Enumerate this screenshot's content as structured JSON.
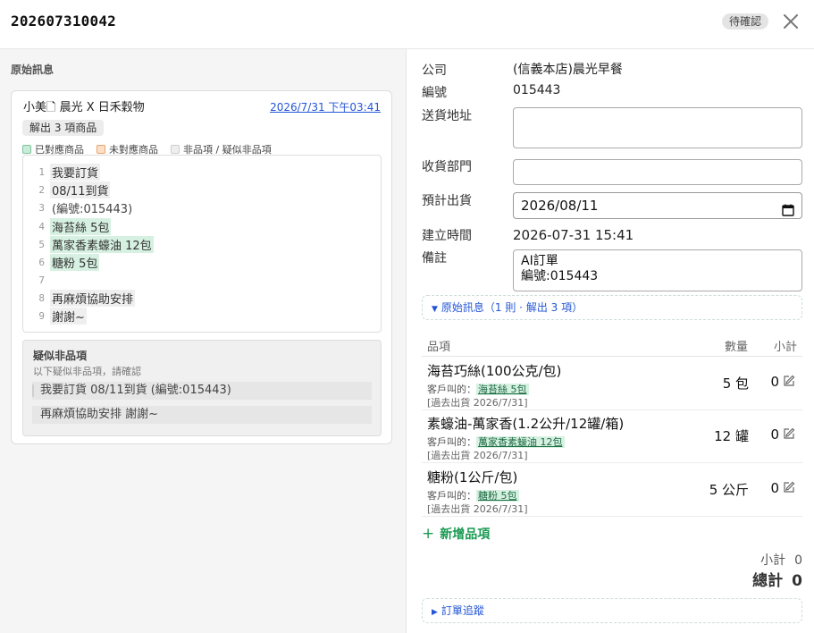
{
  "header": {
    "order_no": "202607310042",
    "status": "待確認"
  },
  "left": {
    "title": "原始訊息",
    "sender": "小美🗋 晨光 X 日禾穀物",
    "time": "2026/7/31 下午03:41",
    "parse_badge": "解出 3 項商品",
    "legend": {
      "matched": "已對應商品",
      "unmatched": "未對應商品",
      "nonitem": "非品項 / 疑似非品項"
    },
    "lines": [
      {
        "n": "1",
        "text": "我要訂貨",
        "kind": "nonitem"
      },
      {
        "n": "2",
        "text": "08/11到貨",
        "kind": "nonitem"
      },
      {
        "n": "3",
        "text": "(編號:015443)",
        "kind": "plain"
      },
      {
        "n": "4",
        "text": "海苔絲 5包",
        "kind": "matched"
      },
      {
        "n": "5",
        "text": "萬家香素蠔油 12包",
        "kind": "matched"
      },
      {
        "n": "6",
        "text": "糖粉 5包",
        "kind": "matched"
      },
      {
        "n": "7",
        "text": "",
        "kind": "plain"
      },
      {
        "n": "8",
        "text": "再麻煩協助安排",
        "kind": "nonitem"
      },
      {
        "n": "9",
        "text": "謝謝~",
        "kind": "nonitem"
      }
    ],
    "suspect": {
      "title": "疑似非品項",
      "subtitle": "以下疑似非品項，請確認",
      "rows": [
        "我要訂貨 08/11到貨 (編號:015443)",
        "再麻煩協助安排 謝謝~"
      ]
    }
  },
  "form": {
    "company_label": "公司",
    "company_value": "(信義本店)晨光早餐",
    "number_label": "編號",
    "number_value": "015443",
    "address_label": "送貨地址",
    "address_value": "",
    "dept_label": "收貨部門",
    "dept_value": "",
    "ship_label": "預計出貨",
    "ship_value": "2026/08/11",
    "created_label": "建立時間",
    "created_value": "2026-07-31 15:41",
    "note_label": "備註",
    "note_line1": "AI訂單",
    "note_line2": "編號:015443"
  },
  "raw_toggle": "原始訊息（1 則 · 解出 3 項）",
  "items": {
    "col_item": "品項",
    "col_qty": "數量",
    "col_sub": "小計",
    "cust_prefix": "客戶叫的：",
    "rows": [
      {
        "name": "海苔巧絲(100公克/包)",
        "cust": "海苔絲 5包",
        "hist": "[過去出貨 2026/7/31]",
        "qty": "5 包",
        "sub": "0"
      },
      {
        "name": "素蠔油-萬家香(1.2公升/12罐/箱)",
        "cust": "萬家香素蠔油 12包",
        "hist": "[過去出貨 2026/7/31]",
        "qty": "12 罐",
        "sub": "0"
      },
      {
        "name": "糖粉(1公斤/包)",
        "cust": "糖粉 5包",
        "hist": "[過去出貨 2026/7/31]",
        "qty": "5 公斤",
        "sub": "0"
      }
    ],
    "add_label": "新增品項"
  },
  "summary": {
    "subtotal_label": "小計",
    "subtotal_value": "0",
    "total_label": "總計",
    "total_value": "0"
  },
  "tracking_toggle": "訂單追蹤",
  "colors": {
    "matched_bg": "#d6f1e2",
    "link_blue": "#2456d6",
    "add_green": "#1a9a52"
  }
}
